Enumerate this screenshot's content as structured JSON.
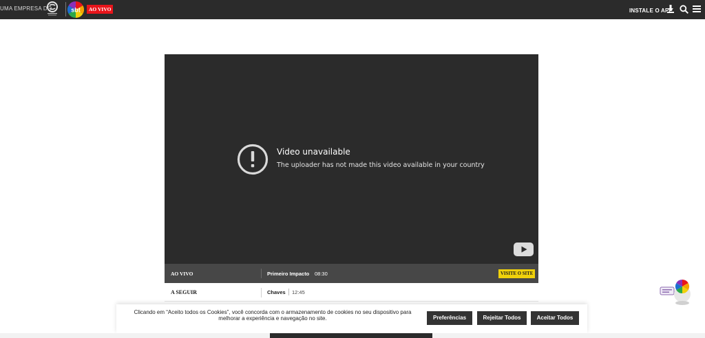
{
  "header": {
    "tagline": "UMA EMPRESA DO",
    "group_logo_text": "GRUPO SILVIO SANTOS",
    "brand_logo_text": "sbt",
    "live_badge": "AO VIVO",
    "install_label": "INSTALE O APP",
    "icons": [
      "download-icon",
      "search-icon",
      "menu-icon"
    ]
  },
  "player": {
    "error_title": "Video unavailable",
    "error_message": "The uploader has not made this video available in your country"
  },
  "schedule": {
    "now_label": "AO VIVO",
    "now_program": "Primeiro Impacto",
    "now_time": "08:30",
    "visit_button": "VISITE O SITE",
    "next_label": "A SEGUIR",
    "next_program": "Chaves",
    "next_time": "12:45"
  },
  "cookie_banner": {
    "text": "Clicando em “Aceito todos os Cookies”, você concorda com o armazenamento de cookies no seu dispositivo para melhorar a experiência e navegação no site.",
    "preferences_button": "Preferências",
    "reject_button": "Rejeitar Todos",
    "accept_button": "Aceitar Todos"
  },
  "colors": {
    "topbar": "#2b2b2b",
    "live_red": "#e8151b",
    "visit_yellow": "#f0d10b",
    "button_dark": "#333333"
  }
}
